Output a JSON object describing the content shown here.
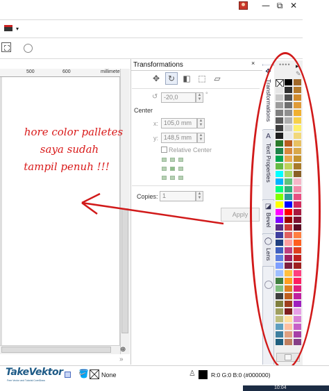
{
  "window": {
    "minimize_glyph": "—",
    "restore_glyph": "⧉",
    "close_glyph": "✕"
  },
  "toolbar": {
    "dropdown_glyph": "▾"
  },
  "ruler": {
    "ticks": [
      "500",
      "600"
    ],
    "unit": "millimeters"
  },
  "docker": {
    "title": "Transformations",
    "close_glyph": "×",
    "tool_buttons": [
      {
        "icon": "position-icon",
        "glyph": "✥"
      },
      {
        "icon": "rotate-icon",
        "glyph": "↻"
      },
      {
        "icon": "mirror-icon",
        "glyph": "◧"
      },
      {
        "icon": "size-icon",
        "glyph": "⬚"
      },
      {
        "icon": "skew-icon",
        "glyph": "▱"
      }
    ],
    "rotation": {
      "value": "-20,0",
      "unit": "°"
    },
    "center": {
      "heading": "Center",
      "x_label": "x:",
      "x_value": "105,0 mm",
      "y_label": "y:",
      "y_value": "148,5 mm",
      "relative_center_label": "Relative Center",
      "relative_center_checked": false
    },
    "copies": {
      "label": "Copies:",
      "value": "1"
    },
    "apply_label": "Apply"
  },
  "docker_tabs": [
    {
      "label": "Transformations",
      "active": true,
      "glyph": "✥"
    },
    {
      "label": "Text Properties",
      "active": false,
      "glyph": "A"
    },
    {
      "label": "Bevel",
      "active": false,
      "glyph": "◪"
    },
    {
      "label": "Lens",
      "active": false,
      "glyph": "◯"
    }
  ],
  "palette": {
    "menu_glyph": "▸",
    "dots_glyph": "••••",
    "eyedropper_glyph": "✎",
    "columns": [
      [
        "#ffffff",
        "#e6e6e6",
        "#c8c8c8",
        "#9c9c9c",
        "#7f7f7f",
        "#5c5c5c",
        "#3d3d3d",
        "#1f1f1f",
        "#2a7a2a",
        "#1e8449",
        "#00a651",
        "#66bb44",
        "#00ffff",
        "#00b2ff",
        "#00ff7f",
        "#80ff00",
        "#ffff00",
        "#ff00ff",
        "#7f00ff",
        "#5a2d82",
        "#3f3f9f",
        "#1f3f7f",
        "#3f5fbf",
        "#5f7fdf",
        "#7f9fff",
        "#9fbfff",
        "#3f7f3f",
        "#7fbf7f",
        "#3f3f3f",
        "#7f7f3f",
        "#9f9f5f",
        "#bfbf7f",
        "#5f9fbf",
        "#3f7f9f",
        "#1f5f7f"
      ],
      [
        "#000000",
        "#2f2f2f",
        "#4f4f4f",
        "#6f6f6f",
        "#8f8f8f",
        "#afafaf",
        "#cfcfcf",
        "#e8e8e8",
        "#b85d20",
        "#d8893b",
        "#e6a84e",
        "#c1d25a",
        "#a6d86b",
        "#5fc27b",
        "#31b27a",
        "#2c9c9c",
        "#0000ff",
        "#ff0000",
        "#9b0000",
        "#cd3b3b",
        "#e06060",
        "#ff9f9f",
        "#bf3f7f",
        "#9f1f5f",
        "#7f1f3f",
        "#ffbf3f",
        "#ff9f1f",
        "#df7f1f",
        "#bf5f1f",
        "#9f3f1f",
        "#7f1f1f",
        "#ffdf9f",
        "#ffbf9f",
        "#df9f7f",
        "#bf7f5f"
      ],
      [
        "#a0682a",
        "#b47a2c",
        "#d08a2c",
        "#e09b38",
        "#f0b030",
        "#f7d04a",
        "#fff06a",
        "#f2d87a",
        "#e8c061",
        "#d9a84a",
        "#c4922e",
        "#a87b2a",
        "#8a6026",
        "#f5b7c8",
        "#f28aa8",
        "#e84f82",
        "#d12a5c",
        "#a8183e",
        "#7f1030",
        "#5c0a22",
        "#ff7f3f",
        "#ff5f1f",
        "#df3f1f",
        "#bf1f1f",
        "#9f1f1f",
        "#ff3f7f",
        "#ff1f5f",
        "#df1f7f",
        "#bf1f9f",
        "#9f1fbf",
        "#e7a0e7",
        "#d77fd7",
        "#c75fc7",
        "#a73fa7",
        "#873f87"
      ]
    ]
  },
  "annotation": {
    "lines": [
      "hore color palletes",
      "saya sudah",
      "tampil penuh !!!"
    ]
  },
  "statusbar": {
    "logo": "TakeVektor",
    "logo_tagline": "Free Vector and Tutorial CorelDraw",
    "fill_label": "None",
    "outline_label": "R:0 G:0 B:0 (#000000)",
    "clock": "10:04"
  },
  "colors": {
    "annotation_red": "#d11a1a",
    "logo_blue": "#1d5a86"
  }
}
